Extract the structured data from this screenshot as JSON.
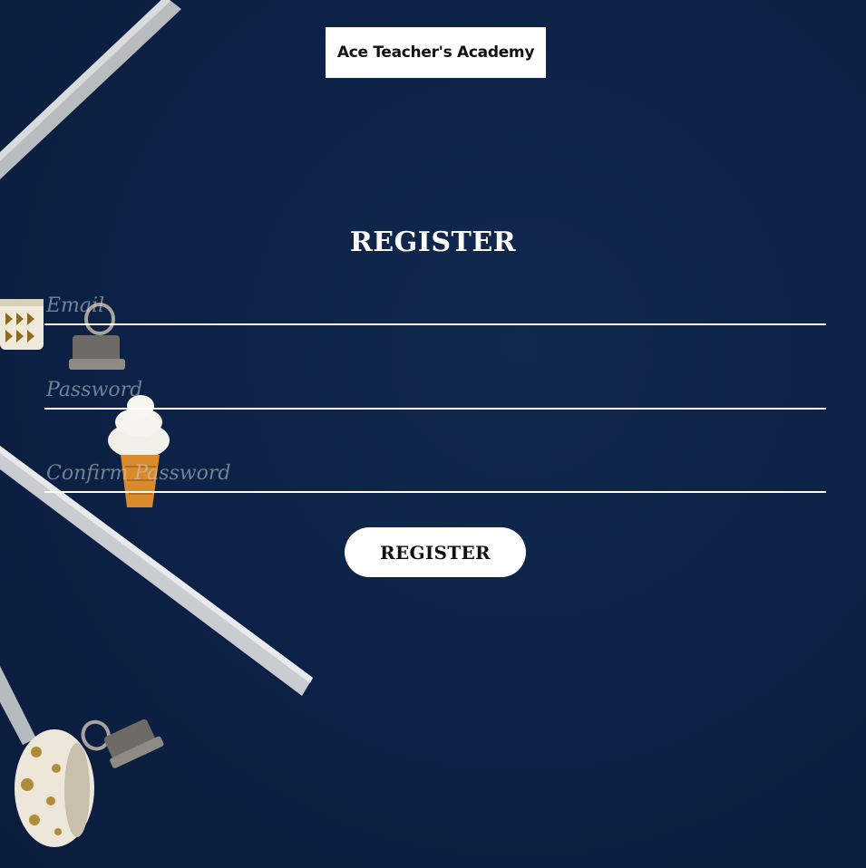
{
  "brand": {
    "title": "Ace Teacher's Academy"
  },
  "form": {
    "heading": "REGISTER",
    "email": {
      "placeholder": "Email",
      "value": ""
    },
    "password": {
      "placeholder": "Password",
      "value": ""
    },
    "confirm_password": {
      "placeholder": "Confirm Password",
      "value": ""
    },
    "submit_label": "REGISTER"
  },
  "colors": {
    "background": "#0d2247",
    "accent": "#ffffff"
  },
  "decor": [
    "pencil",
    "washi-tape",
    "binder-clip",
    "ice-cream-cone"
  ]
}
